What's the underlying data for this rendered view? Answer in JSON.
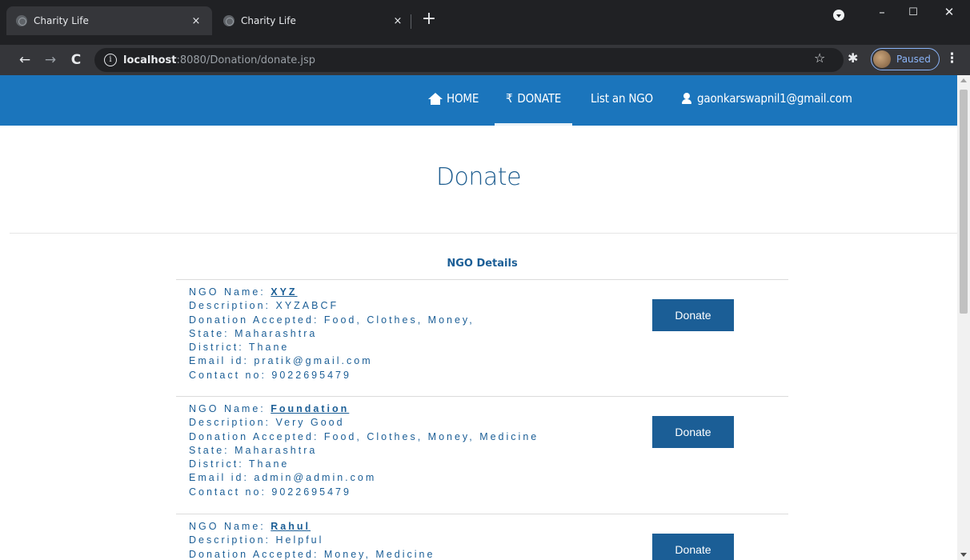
{
  "browser": {
    "tabs": [
      {
        "title": "Charity Life",
        "active": true
      },
      {
        "title": "Charity Life",
        "active": false
      }
    ],
    "close_glyph": "×",
    "new_tab_glyph": "+",
    "window_controls": {
      "minimize": "–",
      "maximize": "☐",
      "close": "✕"
    },
    "url_host": "localhost",
    "url_rest": ":8080/Donation/donate.jsp",
    "info_glyph": "i",
    "profile_status": "Paused",
    "back_glyph": "←",
    "forward_glyph": "→",
    "reload_glyph": "C",
    "star_glyph": "☆",
    "extensions_glyph": "✱",
    "menu_glyph": "⋮"
  },
  "site_nav": {
    "home": "HOME",
    "donate_symbol": "₹",
    "donate": "DONATE",
    "list_ngo": "List an NGO",
    "user_email": "gaonkarswapnil1@gmail.com"
  },
  "page": {
    "title": "Donate",
    "table_title": "NGO Details",
    "labels": {
      "name": "NGO Name: ",
      "description": "Description: ",
      "accepted": "Donation Accepted: ",
      "state": "State: ",
      "district": "District: ",
      "email": "Email id: ",
      "contact": "Contact no: "
    },
    "button_label": "Donate",
    "ngos": [
      {
        "name": "XYZ",
        "description": "XYZABCF",
        "accepted": "Food, Clothes, Money,",
        "state": "Maharashtra",
        "district": "Thane",
        "email": "pratik@gmail.com",
        "contact": "9022695479"
      },
      {
        "name": "Foundation",
        "description": "Very Good",
        "accepted": "Food, Clothes, Money, Medicine",
        "state": "Maharashtra",
        "district": "Thane",
        "email": "admin@admin.com",
        "contact": "9022695479"
      },
      {
        "name": "Rahul",
        "description": "Helpful",
        "accepted": "Money, Medicine"
      }
    ]
  },
  "colors": {
    "nav_blue": "#1b75bc",
    "text_blue": "#1b5e96",
    "button_blue": "#1b5e96"
  }
}
